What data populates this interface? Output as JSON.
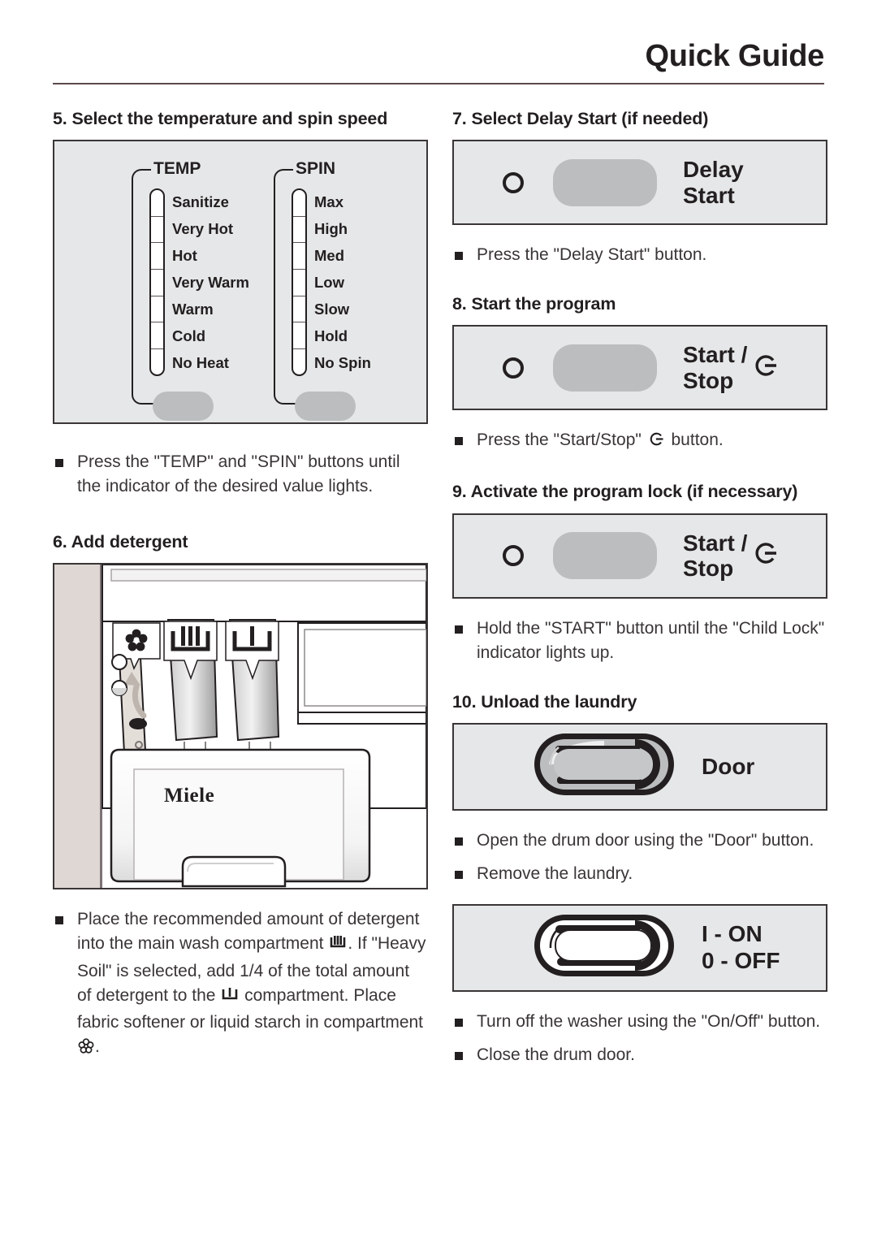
{
  "header": {
    "title": "Quick Guide"
  },
  "left_column": {
    "step5": {
      "heading": "5. Select the temperature and spin speed",
      "panel": {
        "temp": {
          "title": "TEMP",
          "options": [
            "Sanitize",
            "Very Hot",
            "Hot",
            "Very Warm",
            "Warm",
            "Cold",
            "No Heat"
          ]
        },
        "spin": {
          "title": "SPIN",
          "options": [
            "Max",
            "High",
            "Med",
            "Low",
            "Slow",
            "Hold",
            "No Spin"
          ]
        }
      },
      "bullets": [
        "Press the \"TEMP\" and \"SPIN\" buttons until the indicator of the desired value lights."
      ]
    },
    "step6": {
      "heading": "6. Add detergent",
      "drawer": {
        "brand": "Miele",
        "compartment_symbols": [
          "flower-softener-icon",
          "main-wash-icon",
          "prewash-icon"
        ]
      },
      "bullet_parts": {
        "p1": "Place the recommended amount of detergent into the main wash compartment ",
        "p2": ". If \"Heavy Soil\" is selected, add 1/4 of the total amount of detergent to the ",
        "p3": " compartment. Place fabric softener or liquid starch in compartment ",
        "p4": "."
      }
    }
  },
  "right_column": {
    "step7": {
      "heading": "7. Select Delay Start (if needed)",
      "panel": {
        "label": "Delay\nStart",
        "has_led": true,
        "has_key": true
      },
      "bullets": [
        "Press the \"Delay Start\" button."
      ]
    },
    "step8": {
      "heading": "8. Start the program",
      "panel": {
        "label": "Start /\nStop",
        "has_led": true,
        "has_key": true,
        "icon": "start-stop-icon"
      },
      "bullet_parts": {
        "p1": "Press the \"Start/Stop\" ",
        "p2": " button."
      }
    },
    "step9": {
      "heading": "9. Activate the program lock (if necessary)",
      "panel": {
        "label": "Start /\nStop",
        "has_led": true,
        "has_key": true,
        "icon": "start-stop-icon"
      },
      "bullets": [
        "Hold the \"START\" button until the \"Child Lock\" indicator lights up."
      ]
    },
    "step10": {
      "heading": "10. Unload the laundry",
      "door_panel": {
        "label": "Door"
      },
      "bullets_a": [
        "Open the drum door using the \"Door\" button.",
        "Remove the laundry."
      ],
      "onoff_panel": {
        "label": "I - ON\n0 - OFF"
      },
      "bullets_b": [
        "Turn off the washer using the \"On/Off\" button.",
        "Close the drum door."
      ]
    }
  },
  "colors": {
    "ink": "#231f20",
    "panel_fill": "#e6e7e8",
    "panel_border": "#3a3537",
    "key_gray": "#bcbdbf",
    "rule": "#5b4a4a"
  }
}
